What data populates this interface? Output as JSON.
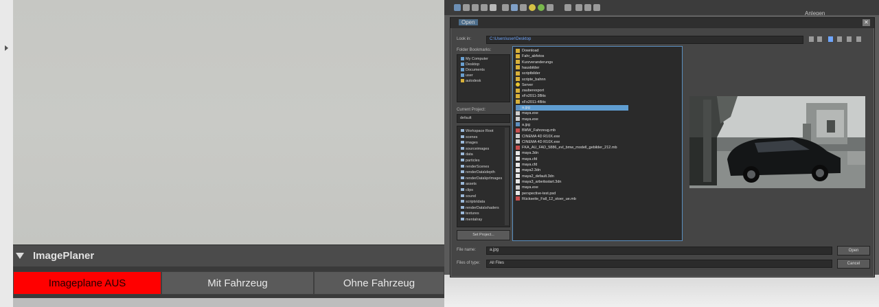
{
  "image_planer": {
    "title": "ImagePlaner",
    "buttons": {
      "aus": "Imageplane AUS",
      "mit": "Mit Fahrzeug",
      "ohne": "Ohne Fahrzeug"
    },
    "active_color": "#ff0000"
  },
  "app": {
    "toolbar_right_label": "Anlegen"
  },
  "open_dialog": {
    "title": "Open",
    "look_in_label": "Look in:",
    "look_in_value": "C:\\Users\\user\\Desktop",
    "folder_bookmarks_label": "Folder Bookmarks:",
    "bookmarks": [
      "My Computer",
      "Desktop",
      "Documents",
      "user",
      "autodesk"
    ],
    "current_project_label": "Current Project:",
    "current_project_value": "default",
    "project_items": [
      "Workspace Root",
      "scenes",
      "images",
      "sourceimages",
      "data",
      "particles",
      "renderScenes",
      "renderData\\depth",
      "renderData\\iprImages",
      "assets",
      "clips",
      "sound",
      "scripts\\data",
      "renderData\\shaders",
      "textures",
      "mentalray"
    ],
    "set_project_button": "Set Project...",
    "files": [
      {
        "name": "Download",
        "icon": "folder"
      },
      {
        "name": "Fahr_abfotos",
        "icon": "folder"
      },
      {
        "name": "Kurzveranderungs",
        "icon": "folder"
      },
      {
        "name": "hausbilder",
        "icon": "folder"
      },
      {
        "name": "scriptbilder",
        "icon": "folder"
      },
      {
        "name": "scripte_bahnn",
        "icon": "folder"
      },
      {
        "name": "Server",
        "icon": "star"
      },
      {
        "name": "zauberexport",
        "icon": "folder"
      },
      {
        "name": "xFx2011-3Bits",
        "icon": "folder"
      },
      {
        "name": "xFx2011-4Bits",
        "icon": "folder"
      },
      {
        "name": "a.jpg",
        "icon": "image"
      },
      {
        "name": "maya.exe",
        "icon": "app"
      },
      {
        "name": "maya.exe",
        "icon": "app"
      },
      {
        "name": "a.jpg",
        "icon": "image"
      },
      {
        "name": "BMW_Fahrzeug.mb",
        "icon": "maya"
      },
      {
        "name": "CINEMA 4D R10X.exe",
        "icon": "app"
      },
      {
        "name": "CINEMA 4D R10X.exe",
        "icon": "app"
      },
      {
        "name": "FKA_AU_FAD_5886_evl_bmw_modell_gebilder_212.mb",
        "icon": "maya"
      },
      {
        "name": "maya.3dn",
        "icon": "doc"
      },
      {
        "name": "maya.cfd",
        "icon": "doc"
      },
      {
        "name": "maya.cfd",
        "icon": "doc"
      },
      {
        "name": "maya2.3dn",
        "icon": "doc"
      },
      {
        "name": "maya2_default.3dn",
        "icon": "doc"
      },
      {
        "name": "maya3_arbeitsstart.3dn",
        "icon": "doc"
      },
      {
        "name": "maya.exe",
        "icon": "app"
      },
      {
        "name": "perspective-test.psd",
        "icon": "doc"
      },
      {
        "name": "Rückseite_Fall_12_stoer_ue.mb",
        "icon": "maya"
      }
    ],
    "selected_file": "a.jpg",
    "file_name_label": "File name:",
    "file_name_value": "a.jpg",
    "files_of_type_label": "Files of type:",
    "files_of_type_value": "All Files",
    "open_button": "Open",
    "cancel_button": "Cancel"
  }
}
